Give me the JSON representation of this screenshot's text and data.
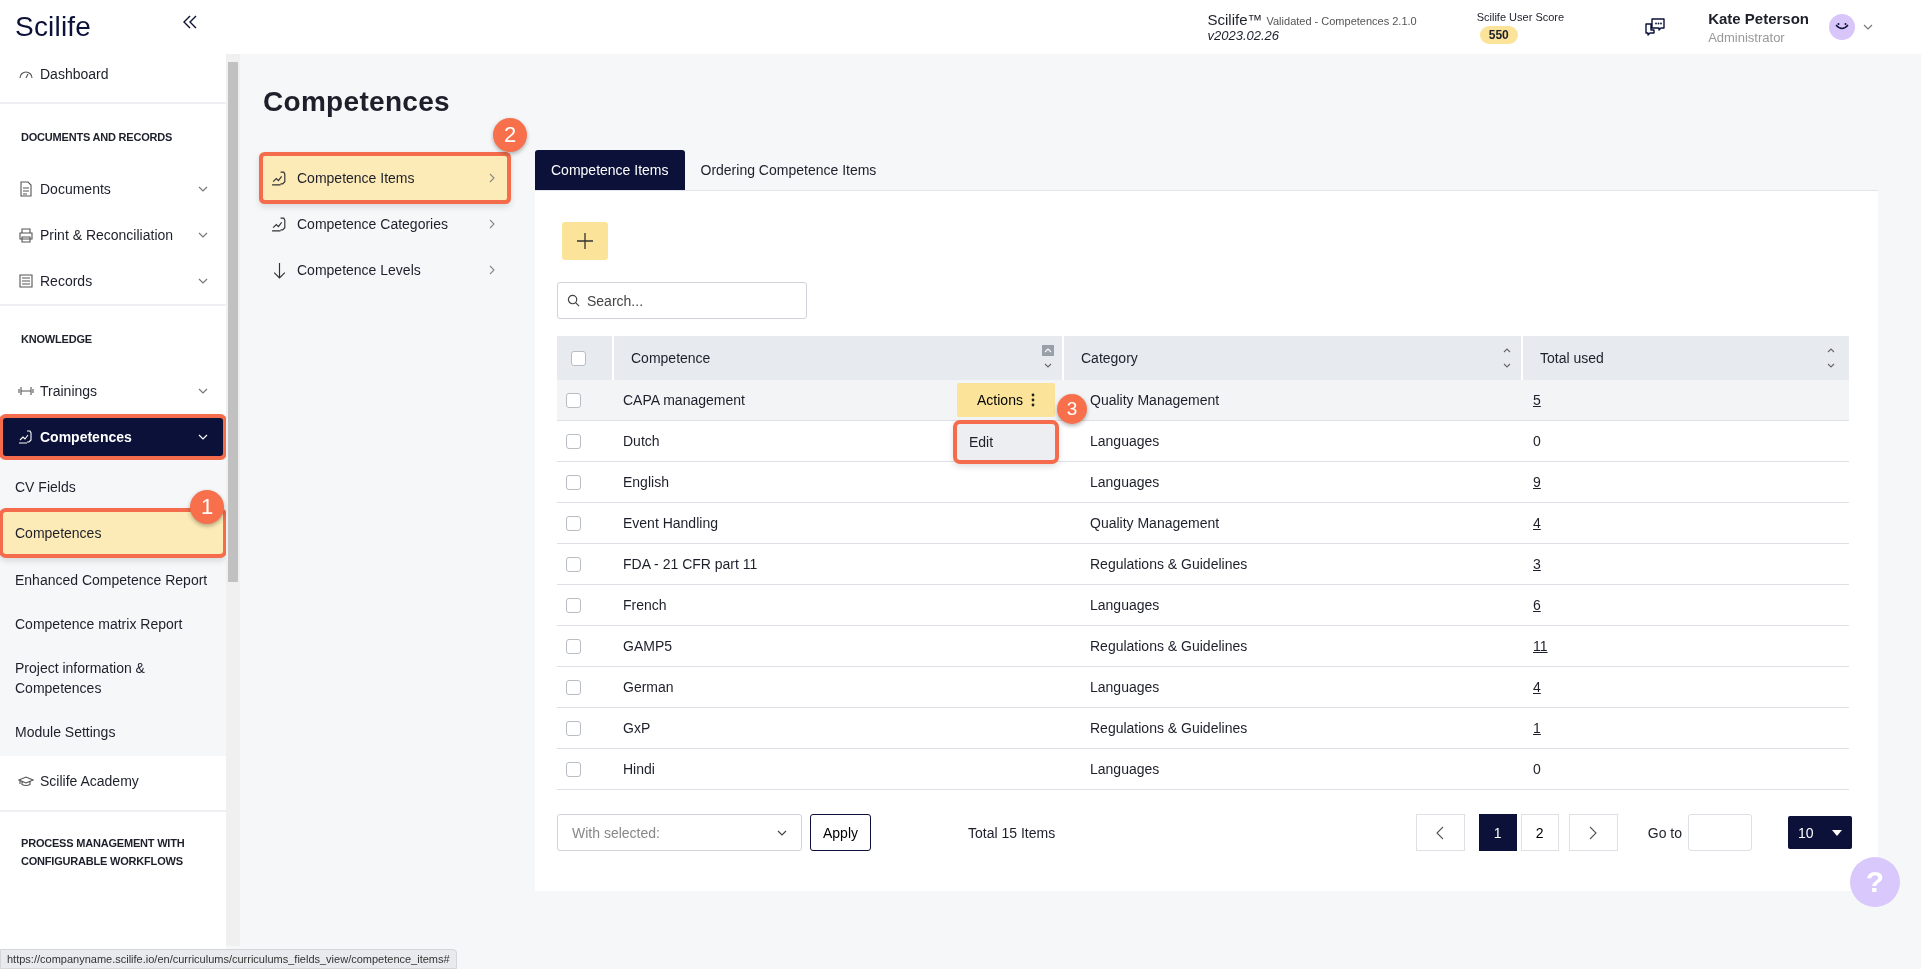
{
  "header": {
    "logo": "Scilife",
    "product": "Scilife™",
    "product_note": "Validated - Competences 2.1.0",
    "version": "v2023.02.26",
    "score_label": "Scilife User Score",
    "score": "550",
    "user_name": "Kate Peterson",
    "user_role": "Administrator"
  },
  "sidebar": {
    "items": [
      {
        "kind": "link",
        "label": "Dashboard",
        "selected": false
      },
      {
        "kind": "heading",
        "label": "DOCUMENTS AND RECORDS"
      },
      {
        "kind": "group",
        "label": "Documents",
        "selected": false
      },
      {
        "kind": "group",
        "label": "Print & Reconciliation",
        "selected": false
      },
      {
        "kind": "group",
        "label": "Records",
        "selected": false
      },
      {
        "kind": "heading",
        "label": "KNOWLEDGE"
      },
      {
        "kind": "group",
        "label": "Trainings",
        "selected": false
      },
      {
        "kind": "group",
        "label": "Competences",
        "selected": true,
        "annotated": true,
        "children": [
          {
            "label": "CV Fields",
            "selected": false
          },
          {
            "label": "Competences",
            "selected": true,
            "annotated": true,
            "callout": "1"
          },
          {
            "label": "Enhanced Competence Report",
            "selected": false
          },
          {
            "label": "Competence matrix Report",
            "selected": false
          },
          {
            "label": "Project information & Competences",
            "selected": false
          },
          {
            "label": "Module Settings",
            "selected": false
          }
        ]
      },
      {
        "kind": "link",
        "label": "Scilife Academy",
        "selected": false
      },
      {
        "kind": "heading",
        "label": "PROCESS MANAGEMENT WITH CONFIGURABLE WORKFLOWS"
      }
    ]
  },
  "page_title": "Competences",
  "subnav": [
    {
      "label": "Competence Items",
      "selected": true,
      "annotated": true,
      "callout": "2"
    },
    {
      "label": "Competence Categories",
      "selected": false
    },
    {
      "label": "Competence Levels",
      "selected": false
    }
  ],
  "tabs": [
    {
      "label": "Competence Items",
      "selected": true
    },
    {
      "label": "Ordering Competence Items",
      "selected": false
    }
  ],
  "search": {
    "placeholder": "Search..."
  },
  "table": {
    "select_all": {
      "checked": false
    },
    "columns": [
      {
        "label": "Competence",
        "sorted": true
      },
      {
        "label": "Category",
        "sorted": false
      },
      {
        "label": "Total used",
        "sorted": false
      }
    ],
    "rows": [
      {
        "competence": "CAPA management",
        "category": "Quality Management",
        "total_used": "5",
        "linked": true,
        "checked": false,
        "hovered": true
      },
      {
        "competence": "Dutch",
        "category": "Languages",
        "total_used": "0",
        "linked": false,
        "checked": false,
        "hovered": false
      },
      {
        "competence": "English",
        "category": "Languages",
        "total_used": "9",
        "linked": true,
        "checked": false,
        "hovered": false
      },
      {
        "competence": "Event Handling",
        "category": "Quality Management",
        "total_used": "4",
        "linked": true,
        "checked": false,
        "hovered": false
      },
      {
        "competence": "FDA - 21 CFR part 11",
        "category": "Regulations & Guidelines",
        "total_used": "3",
        "linked": true,
        "checked": false,
        "hovered": false
      },
      {
        "competence": "French",
        "category": "Languages",
        "total_used": "6",
        "linked": true,
        "checked": false,
        "hovered": false
      },
      {
        "competence": "GAMP5",
        "category": "Regulations & Guidelines",
        "total_used": "11",
        "linked": true,
        "checked": false,
        "hovered": false
      },
      {
        "competence": "German",
        "category": "Languages",
        "total_used": "4",
        "linked": true,
        "checked": false,
        "hovered": false
      },
      {
        "competence": "GxP",
        "category": "Regulations & Guidelines",
        "total_used": "1",
        "linked": true,
        "checked": false,
        "hovered": false
      },
      {
        "competence": "Hindi",
        "category": "Languages",
        "total_used": "0",
        "linked": false,
        "checked": false,
        "hovered": false
      }
    ]
  },
  "actions": {
    "button": "Actions",
    "menu": [
      {
        "label": "Edit",
        "annotated": true,
        "callout": "3"
      }
    ]
  },
  "footer": {
    "bulk_placeholder": "With selected:",
    "apply": "Apply",
    "total": "Total 15 Items",
    "pages": [
      {
        "label": "1",
        "selected": true
      },
      {
        "label": "2",
        "selected": false
      }
    ],
    "goto_label": "Go to",
    "page_size": "10"
  },
  "help": "?",
  "status_url": "https://companyname.scilife.io/en/curriculums/curriculums_fields_view/competence_items#"
}
